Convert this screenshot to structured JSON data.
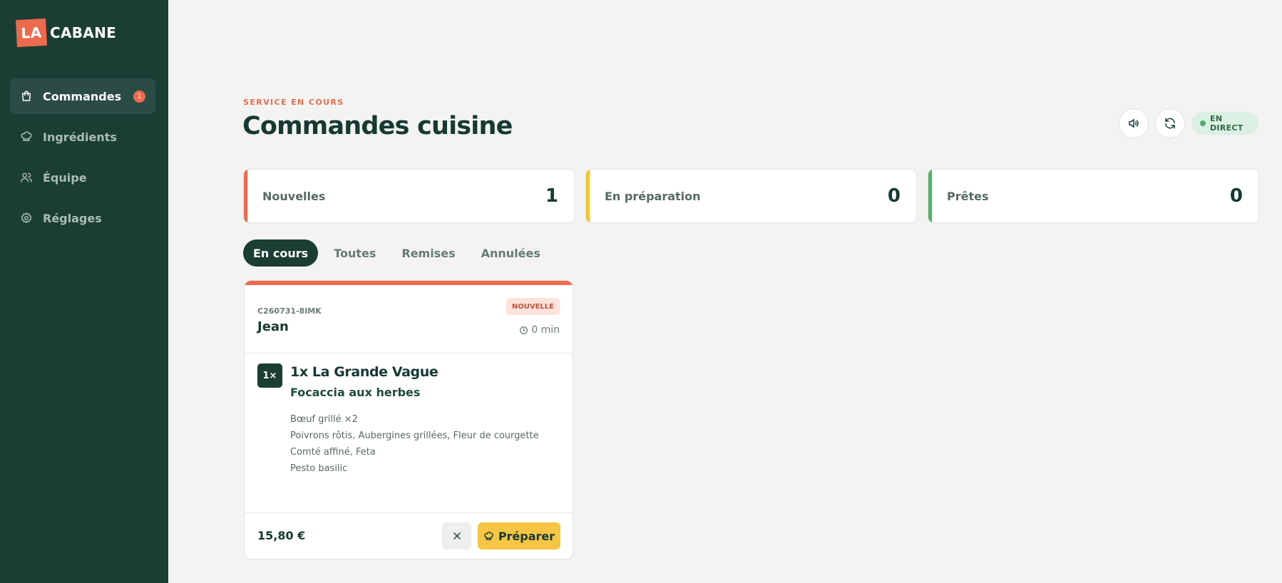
{
  "brand": {
    "logo_la": "LA",
    "logo_cabane": "CABANE"
  },
  "sidebar": {
    "items": [
      {
        "label": "Commandes",
        "icon": "shopping-bag-icon",
        "badge": "1",
        "active": true
      },
      {
        "label": "Ingrédients",
        "icon": "chef-hat-icon"
      },
      {
        "label": "Équipe",
        "icon": "users-icon"
      },
      {
        "label": "Réglages",
        "icon": "gear-icon"
      }
    ]
  },
  "header": {
    "eyebrow": "SERVICE EN COURS",
    "title": "Commandes cuisine",
    "live_label": "EN DIRECT"
  },
  "stats": [
    {
      "label": "Nouvelles",
      "value": "1",
      "color": "#ee6a4e"
    },
    {
      "label": "En préparation",
      "value": "0",
      "color": "#f4c430"
    },
    {
      "label": "Prêtes",
      "value": "0",
      "color": "#59ab6f"
    }
  ],
  "tabs": [
    {
      "label": "En cours",
      "active": true
    },
    {
      "label": "Toutes"
    },
    {
      "label": "Remises"
    },
    {
      "label": "Annulées"
    }
  ],
  "order": {
    "id": "C260731-8IMK",
    "customer": "Jean",
    "status": "NOUVELLE",
    "elapsed": "0 min",
    "qty": "1×",
    "item_title": "1x La Grande Vague",
    "item_subtitle": "Focaccia aux herbes",
    "modifiers": [
      "Bœuf grillé ×2",
      "Poivrons rôtis, Aubergines grillées, Fleur de courgette",
      "Comté affiné, Feta",
      "Pesto basilic"
    ],
    "price": "15,80 €",
    "prepare_label": "Préparer"
  },
  "colors": {
    "sidebar": "#1a3d34",
    "accent": "#ee6a4e",
    "prepare": "#f7c544"
  }
}
